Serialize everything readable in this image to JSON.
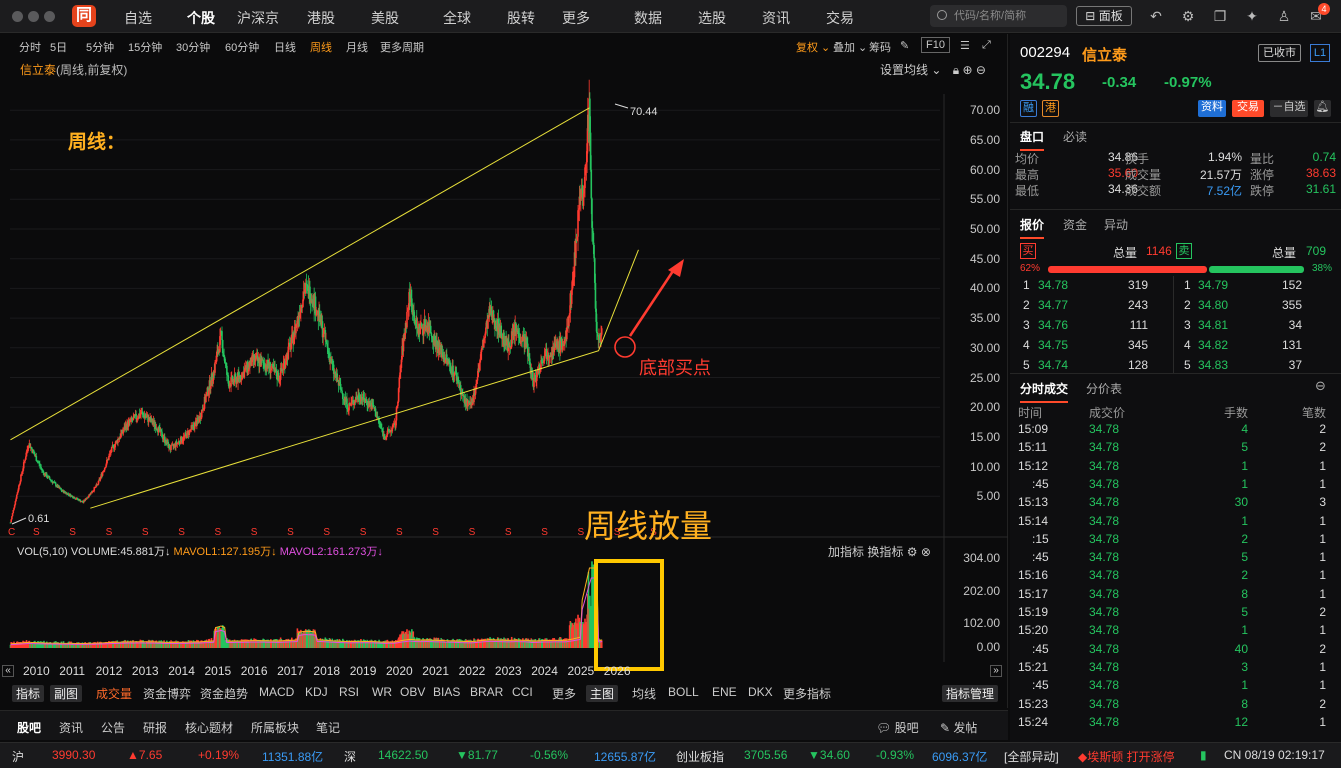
{
  "nav": {
    "logo": "同",
    "items": [
      "自选",
      "个股",
      "沪深京",
      "港股",
      "美股",
      "全球",
      "股转",
      "更多",
      "数据",
      "选股",
      "资讯",
      "交易"
    ],
    "active_index": 1,
    "search_placeholder": "代码/名称/简称",
    "panel_label": "面板",
    "notification_count": "4"
  },
  "periods": {
    "items": [
      "分时",
      "5日",
      "5分钟",
      "15分钟",
      "30分钟",
      "60分钟",
      "日线",
      "周线",
      "月线",
      "更多周期"
    ],
    "active": "周线",
    "right": [
      "复权",
      "叠加",
      "筹码",
      "F10"
    ]
  },
  "stock_title": {
    "name": "信立泰",
    "sub": "(周线,前复权)"
  },
  "set_ma_label": "设置均线",
  "annotations": {
    "weekly": "周线：",
    "bottom_buy": "底部买点",
    "volume_up": "周线放量",
    "high_label": "70.44",
    "low_label": "0.61"
  },
  "chart_data": {
    "type": "candlestick",
    "title": "信立泰 (周线,前复权)",
    "price_axis": {
      "ticks": [
        "70.00",
        "65.00",
        "60.00",
        "55.00",
        "50.00",
        "45.00",
        "40.00",
        "35.00",
        "30.00",
        "25.00",
        "20.00",
        "15.00",
        "10.00",
        "5.00"
      ],
      "range": [
        0,
        72
      ]
    },
    "volume_axis": {
      "ticks": [
        "304.00",
        "202.00",
        "102.00",
        "0.00"
      ],
      "unit": "万"
    },
    "years": [
      "2010",
      "2011",
      "2012",
      "2013",
      "2014",
      "2015",
      "2016",
      "2017",
      "2018",
      "2019",
      "2020",
      "2021",
      "2022",
      "2023",
      "2024",
      "2025",
      "2026"
    ],
    "price_trend": [
      [
        2009.6,
        0.6
      ],
      [
        2010.1,
        14
      ],
      [
        2010.5,
        9
      ],
      [
        2011.0,
        6
      ],
      [
        2011.6,
        4
      ],
      [
        2012.0,
        7
      ],
      [
        2012.4,
        13
      ],
      [
        2012.8,
        17
      ],
      [
        2013.2,
        19
      ],
      [
        2013.6,
        17
      ],
      [
        2014.0,
        13
      ],
      [
        2014.4,
        15
      ],
      [
        2014.8,
        18
      ],
      [
        2015.2,
        26
      ],
      [
        2015.4,
        32
      ],
      [
        2015.6,
        24
      ],
      [
        2015.9,
        25
      ],
      [
        2016.3,
        28
      ],
      [
        2016.7,
        27
      ],
      [
        2017.0,
        25
      ],
      [
        2017.4,
        32
      ],
      [
        2017.7,
        40
      ],
      [
        2017.9,
        39
      ],
      [
        2018.2,
        33
      ],
      [
        2018.5,
        26
      ],
      [
        2018.9,
        20
      ],
      [
        2019.2,
        22
      ],
      [
        2019.6,
        20
      ],
      [
        2019.9,
        15
      ],
      [
        2020.2,
        17
      ],
      [
        2020.4,
        30
      ],
      [
        2020.6,
        39
      ],
      [
        2020.8,
        33
      ],
      [
        2021.1,
        34
      ],
      [
        2021.3,
        31
      ],
      [
        2021.6,
        28
      ],
      [
        2021.9,
        25
      ],
      [
        2022.1,
        21
      ],
      [
        2022.3,
        20
      ],
      [
        2022.6,
        30
      ],
      [
        2022.8,
        36
      ],
      [
        2023.0,
        34
      ],
      [
        2023.3,
        30
      ],
      [
        2023.5,
        33
      ],
      [
        2023.8,
        31
      ],
      [
        2024.0,
        24
      ],
      [
        2024.3,
        29
      ],
      [
        2024.6,
        30
      ],
      [
        2024.9,
        31
      ],
      [
        2025.1,
        42
      ],
      [
        2025.3,
        57
      ],
      [
        2025.4,
        55
      ],
      [
        2025.5,
        68
      ],
      [
        2025.55,
        70.4
      ],
      [
        2025.62,
        52
      ],
      [
        2025.7,
        40
      ],
      [
        2025.75,
        33
      ],
      [
        2025.85,
        30
      ],
      [
        2025.9,
        34.8
      ]
    ],
    "volume": {
      "VOLUME": "45.881万",
      "MAVOL1": "127.195万",
      "MAVOL2": "161.273万"
    },
    "channel_upper": [
      [
        2009.6,
        14.5
      ],
      [
        2025.55,
        70.4
      ]
    ],
    "channel_lower": [
      [
        2011.8,
        3
      ],
      [
        2025.8,
        29.5
      ],
      [
        2026.9,
        46.5
      ]
    ]
  },
  "volume_legend": {
    "name": "VOL(5,10)",
    "volume": "VOLUME:45.881万",
    "mavol1": "MAVOL1:127.195万",
    "mavol2": "MAVOL2:161.273万",
    "add": "加指标",
    "switch": "换指标"
  },
  "indicators": [
    "指标",
    "副图",
    "成交量",
    "资金博弈",
    "资金趋势",
    "MACD",
    "KDJ",
    "RSI",
    "WR",
    "OBV",
    "BIAS",
    "BRAR",
    "CCI",
    "更多",
    "主图",
    "均线",
    "BOLL",
    "ENE",
    "DKX",
    "更多指标",
    "指标管理"
  ],
  "bottom_tabs": [
    "股吧",
    "资讯",
    "公告",
    "研报",
    "核心题材",
    "所属板块",
    "笔记"
  ],
  "bottom_right": [
    "股吧",
    "发帖"
  ],
  "quote": {
    "code": "002294",
    "name": "信立泰",
    "status": "已收市",
    "level": "L1",
    "price": "34.78",
    "change": "-0.34",
    "change_pct": "-0.97%",
    "tags": [
      "融",
      "港"
    ],
    "actions": [
      "资料",
      "交易",
      "－自选"
    ]
  },
  "pankou": {
    "tabs": [
      "盘口",
      "必读"
    ],
    "rows": [
      [
        "均价",
        "34.86",
        "换手",
        "1.94%",
        "量比",
        "0.74"
      ],
      [
        "最高",
        "35.60",
        "成交量",
        "21.57万",
        "涨停",
        "38.63"
      ],
      [
        "最低",
        "34.36",
        "成交额",
        "7.52亿",
        "跌停",
        "31.61"
      ]
    ]
  },
  "orderbook": {
    "tabs": [
      "报价",
      "资金",
      "异动"
    ],
    "buy_label": "买",
    "sell_label": "卖",
    "total_label": "总量",
    "buy_total": "1146",
    "sell_total": "709",
    "buy_ratio": "62%",
    "sell_ratio": "38%",
    "bids": [
      [
        "1",
        "34.78",
        "319"
      ],
      [
        "2",
        "34.77",
        "243"
      ],
      [
        "3",
        "34.76",
        "111"
      ],
      [
        "4",
        "34.75",
        "345"
      ],
      [
        "5",
        "34.74",
        "128"
      ]
    ],
    "asks": [
      [
        "1",
        "34.79",
        "152"
      ],
      [
        "2",
        "34.80",
        "355"
      ],
      [
        "3",
        "34.81",
        "34"
      ],
      [
        "4",
        "34.82",
        "131"
      ],
      [
        "5",
        "34.83",
        "37"
      ]
    ]
  },
  "ticks": {
    "tabs": [
      "分时成交",
      "分价表"
    ],
    "headers": [
      "时间",
      "成交价",
      "手数",
      "笔数"
    ],
    "rows": [
      [
        "15:09",
        "34.78",
        "4",
        "2"
      ],
      [
        "15:11",
        "34.78",
        "5",
        "2"
      ],
      [
        "15:12",
        "34.78",
        "1",
        "1"
      ],
      [
        ":45",
        "34.78",
        "1",
        "1"
      ],
      [
        "15:13",
        "34.78",
        "30",
        "3"
      ],
      [
        "15:14",
        "34.78",
        "1",
        "1"
      ],
      [
        ":15",
        "34.78",
        "2",
        "1"
      ],
      [
        ":45",
        "34.78",
        "5",
        "1"
      ],
      [
        "15:16",
        "34.78",
        "2",
        "1"
      ],
      [
        "15:17",
        "34.78",
        "8",
        "1"
      ],
      [
        "15:19",
        "34.78",
        "5",
        "2"
      ],
      [
        "15:20",
        "34.78",
        "1",
        "1"
      ],
      [
        ":45",
        "34.78",
        "40",
        "2"
      ],
      [
        "15:21",
        "34.78",
        "3",
        "1"
      ],
      [
        ":45",
        "34.78",
        "1",
        "1"
      ],
      [
        "15:23",
        "34.78",
        "8",
        "2"
      ],
      [
        "15:24",
        "34.78",
        "12",
        "1"
      ]
    ]
  },
  "statusbar": {
    "sh": [
      "沪",
      "3990.30",
      "7.65",
      "+0.19%",
      "11351.88亿"
    ],
    "sz": [
      "深",
      "14622.50",
      "81.77",
      "-0.56%",
      "12655.87亿"
    ],
    "cy": [
      "创业板指",
      "3705.56",
      "34.60",
      "-0.93%",
      "6096.37亿"
    ],
    "alert": "[全部异动]",
    "news": "埃斯顿 打开涨停",
    "time": "CN 08/19 02:19:17"
  },
  "colors": {
    "up": "#ff3b30",
    "down": "#25c45f",
    "accent": "#ff9b1a",
    "channel": "#e8e03a"
  }
}
